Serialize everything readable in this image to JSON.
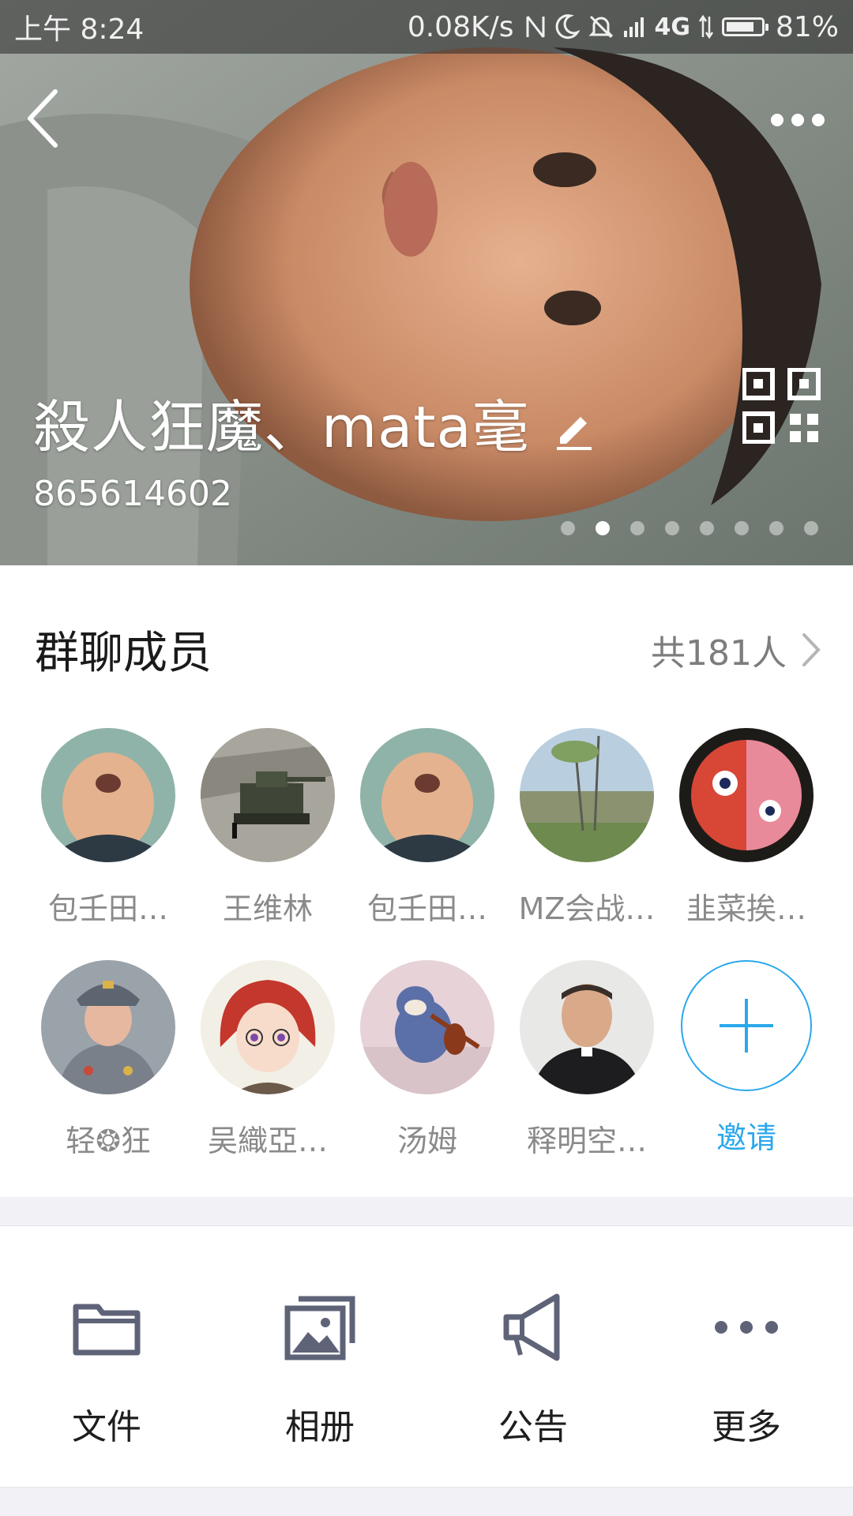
{
  "status_bar": {
    "time": "上午 8:24",
    "network_speed": "0.08K/s",
    "network_type": "4G",
    "battery_percent": "81%",
    "battery_level": 0.81
  },
  "header": {
    "group_name": "殺人狂魔、mata毫",
    "group_id": "865614602",
    "carousel": {
      "total_pages": 8,
      "active_page": 2
    }
  },
  "members": {
    "title": "群聊成员",
    "count_label": "共181人",
    "list": [
      {
        "name": "包壬田…",
        "avatar": "portrait-avatar"
      },
      {
        "name": "王维林",
        "avatar": "tank-photo-avatar"
      },
      {
        "name": "包壬田…",
        "avatar": "portrait-avatar"
      },
      {
        "name": "MZ会战…",
        "avatar": "river-landscape-avatar"
      },
      {
        "name": "韭菜挨…",
        "avatar": "red-face-cartoon-avatar"
      },
      {
        "name": "轻❂狂",
        "avatar": "military-officer-avatar"
      },
      {
        "name": "吴織亞…",
        "avatar": "anime-girl-avatar"
      },
      {
        "name": "汤姆",
        "avatar": "cartoon-cat-avatar"
      },
      {
        "name": "释明空…",
        "avatar": "priest-portrait-avatar"
      }
    ],
    "invite_label": "邀请"
  },
  "tools": [
    {
      "label": "文件",
      "icon": "folder-icon"
    },
    {
      "label": "相册",
      "icon": "album-icon"
    },
    {
      "label": "公告",
      "icon": "megaphone-icon"
    },
    {
      "label": "更多",
      "icon": "more-dots-icon"
    }
  ],
  "colors": {
    "accent": "#2aa8ec",
    "icon_gray": "#5f6378",
    "text_secondary": "#8a8a8a"
  }
}
